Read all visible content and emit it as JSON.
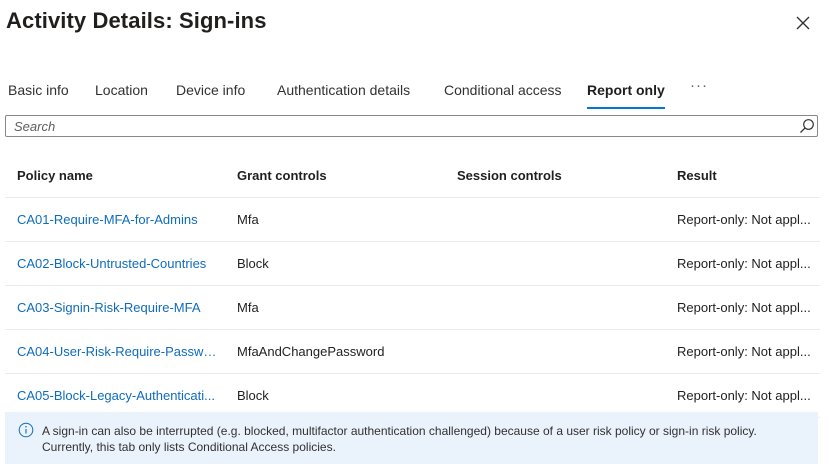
{
  "header": {
    "title": "Activity Details: Sign-ins"
  },
  "tabs": [
    {
      "label": "Basic info"
    },
    {
      "label": "Location"
    },
    {
      "label": "Device info"
    },
    {
      "label": "Authentication details"
    },
    {
      "label": "Conditional access"
    },
    {
      "label": "Report only",
      "active": true
    },
    {
      "label": "···"
    }
  ],
  "search": {
    "placeholder": "Search",
    "value": ""
  },
  "table": {
    "columns": [
      "Policy name",
      "Grant controls",
      "Session controls",
      "Result"
    ],
    "rows": [
      {
        "policy": "CA01-Require-MFA-for-Admins",
        "grant": "Mfa",
        "session": "",
        "result": "Report-only: Not appl..."
      },
      {
        "policy": "CA02-Block-Untrusted-Countries",
        "grant": "Block",
        "session": "",
        "result": "Report-only: Not appl..."
      },
      {
        "policy": "CA03-Signin-Risk-Require-MFA",
        "grant": "Mfa",
        "session": "",
        "result": "Report-only: Not appl..."
      },
      {
        "policy": "CA04-User-Risk-Require-Passwor...",
        "grant": "MfaAndChangePassword",
        "session": "",
        "result": "Report-only: Not appl..."
      },
      {
        "policy": "CA05-Block-Legacy-Authenticati...",
        "grant": "Block",
        "session": "",
        "result": "Report-only: Not appl..."
      }
    ]
  },
  "info": {
    "line1": "A sign-in can also be interrupted (e.g. blocked, multifactor authentication challenged) because of a user risk policy or sign-in risk policy.",
    "line2": "Currently, this tab only lists Conditional Access policies."
  },
  "colors": {
    "accent": "#0078d4",
    "link": "#0f6cbd",
    "info_bg": "#eaf2fb"
  },
  "icons": {
    "close": "close-icon",
    "search": "search-icon",
    "info": "info-icon"
  }
}
